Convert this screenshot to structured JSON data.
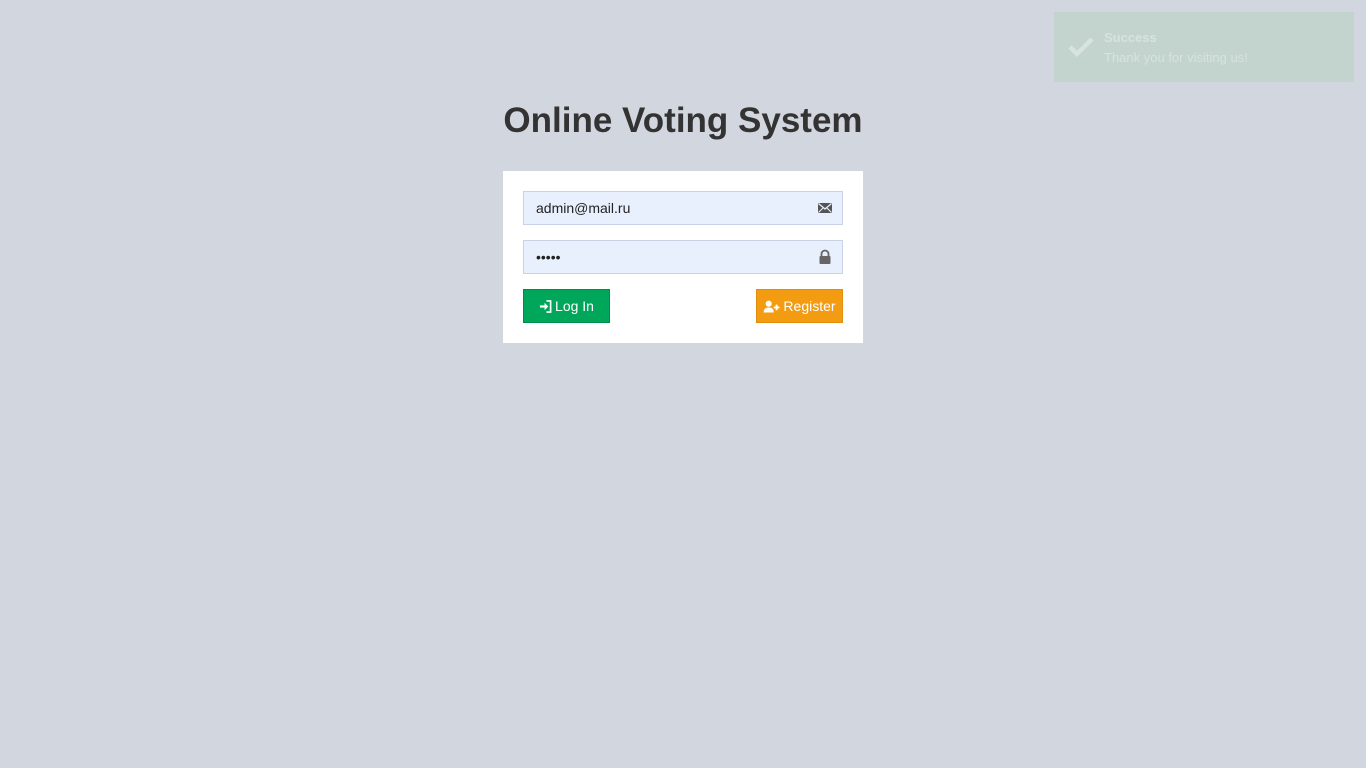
{
  "app": {
    "title": "Online Voting System"
  },
  "login_form": {
    "email_value": "admin@mail.ru",
    "password_value": "•••••",
    "email_icon": "envelope-icon",
    "password_icon": "lock-icon",
    "login_label": "Log In",
    "login_icon": "sign-in-icon",
    "register_label": "Register",
    "register_icon": "user-plus-icon"
  },
  "toast": {
    "title": "Success",
    "message": "Thank you for visiting us!",
    "icon": "check-icon"
  },
  "colors": {
    "background": "#d2d6de",
    "login_button": "#00a65a",
    "register_button": "#f39c12",
    "toast_background": "#c3d4cf"
  }
}
